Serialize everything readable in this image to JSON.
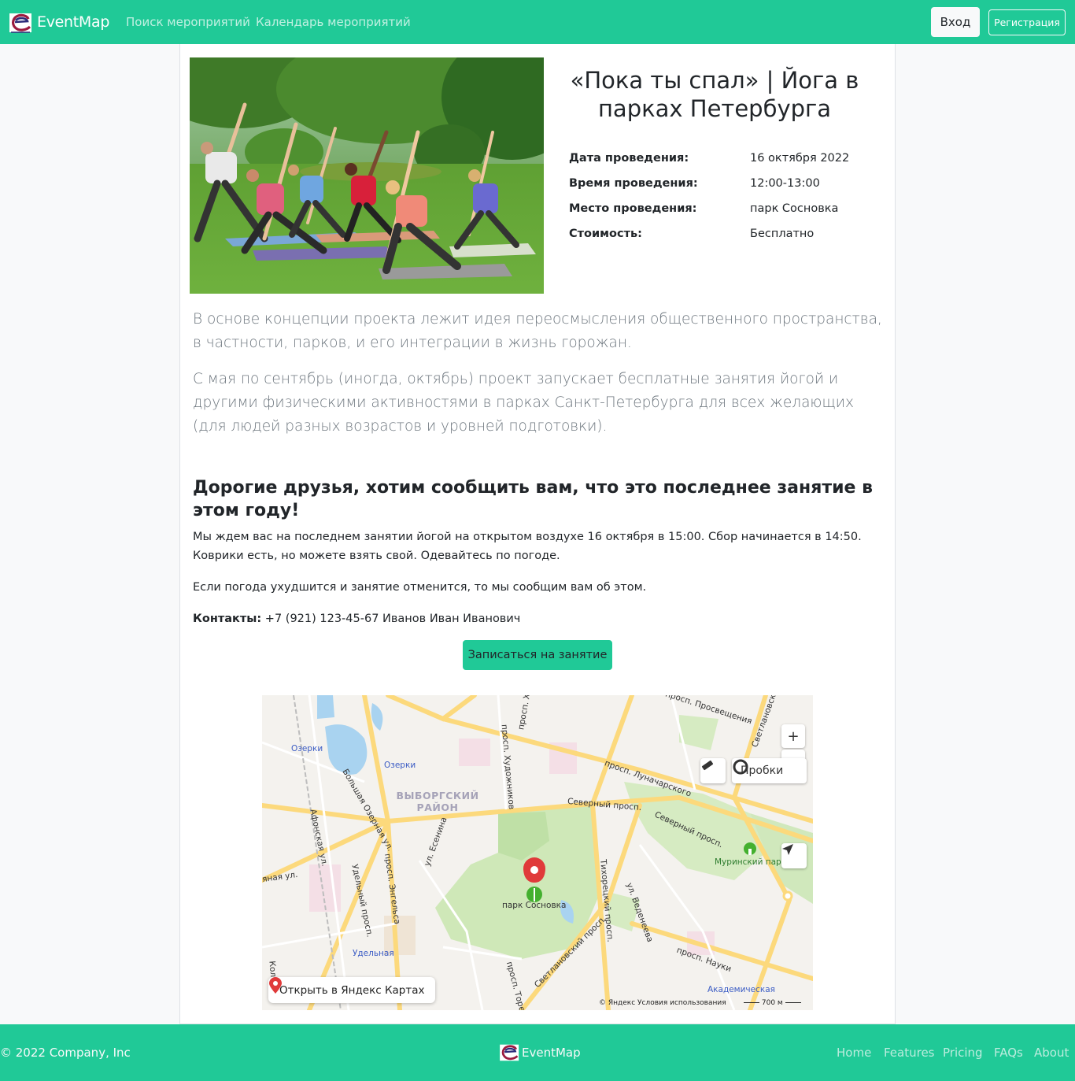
{
  "nav": {
    "brand": "EventMap",
    "links": [
      "Поиск мероприятий",
      "Календарь мероприятий"
    ],
    "login": "Вход",
    "register": "Регистрация"
  },
  "event": {
    "title": "«Пока ты спал» | Йога в парках Петербурга",
    "info": [
      {
        "label": "Дата проведения:",
        "value": "16 октября 2022"
      },
      {
        "label": "Время проведения:",
        "value": "12:00-13:00"
      },
      {
        "label": "Место проведения:",
        "value": "парк Сосновка"
      },
      {
        "label": "Стоимость:",
        "value": "Бесплатно"
      }
    ],
    "lead1": "В основе концепции проекта лежит идея переосмысления общественного пространства, в частности, парков, и его интеграции в жизнь горожан.",
    "lead2": "С мая по сентябрь (иногда, октябрь) проект запускает бесплатные занятия йогой и другими физическими активностями в парках Санкт-Петербурга для всех желающих (для людей разных возрастов и уровней подготовки).",
    "notice_heading": "Дорогие друзья, хотим сообщить вам, что это последнее занятие в этом году!",
    "notice_p1": "Мы ждем вас на последнем занятии йогой на открытом воздухе 16 октября в 15:00. Сбор начинается в 14:50. Коврики есть, но можете взять свой. Одевайтесь по погоде.",
    "notice_p2": "Если погода ухудшится и занятие отменится, то мы сообщим вам об этом.",
    "contacts_label": "Контакты:",
    "contacts_value": " +7 (921) 123-45-67 Иванов Иван Иванович",
    "signup_button": "Записаться на занятие"
  },
  "map": {
    "district_line1": "ВЫБОРГСКИЙ",
    "district_line2": "РАЙОН",
    "labels": {
      "ozerki1": "Озерки",
      "ozerki2": "Озерки",
      "udelnaya": "Удельная",
      "park": "парк Сосновка",
      "murinsky": "Муринский парк",
      "akadem": "Академическая",
      "severny1": "Северный просп.",
      "severny2": "Северный просп.",
      "lunach": "просп. Луначарского",
      "prosv": "просп. Просвещения",
      "svetl": "Светлановский",
      "nauki": "просп. Науки",
      "esenina": "ул. Есенина",
      "engelsa": "просп. Энгельса",
      "udelny": "Удельный просп.",
      "bolsh_ozernaya": "Большая Озерная ул.",
      "afonskaya": "Афонская ул.",
      "khudozh": "просп. Художников",
      "tikhor": "Тихорецкий просп.",
      "vedeneeva": "ул. Веденеева",
      "svetlan_pr": "Светлановский просп.",
      "torez": "просп. Тореза",
      "prosp_x": "просп. Х",
      "kolo": "Коло",
      "yanaya": "яная ул."
    },
    "traffic_label": "Пробки",
    "open_button": "Открыть в Яндекс Картах",
    "copyright": "© Яндекс   Условия использования",
    "scale": "700 м",
    "zoom_in": "+",
    "zoom_out": "−"
  },
  "footer": {
    "copyright": "© 2022 Company, Inc",
    "brand": "EventMap",
    "links": [
      "Home",
      "Features",
      "Pricing",
      "FAQs",
      "About"
    ]
  },
  "colors": {
    "accent": "#20c997",
    "light": "#f8f9fa",
    "muted": "#6c757d",
    "text": "#212529"
  }
}
